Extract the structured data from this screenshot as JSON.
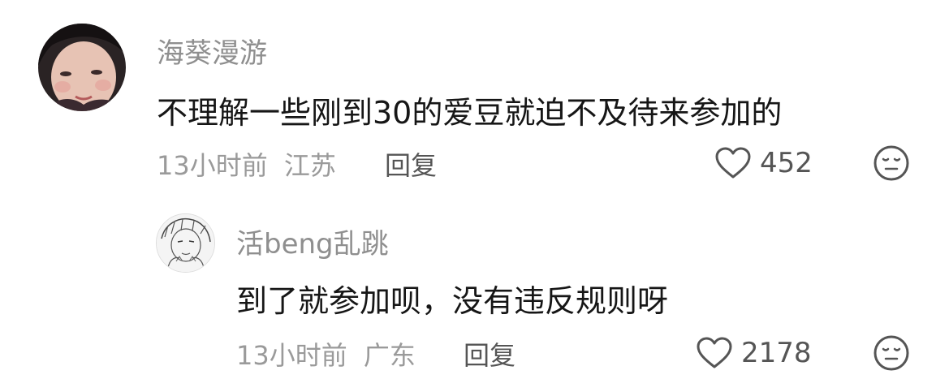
{
  "comments": [
    {
      "username": "海葵漫游",
      "text": "不理解一些刚到30的爱豆就迫不及待来参加的",
      "time": "13小时前",
      "location": "江苏",
      "reply_label": "回复",
      "likes": "452",
      "avatar_icon": "user-avatar-photo",
      "like_icon": "heart-outline-icon",
      "reaction_icon": "neutral-face-icon"
    },
    {
      "username": "活beng乱跳",
      "text": "到了就参加呗，没有违反规则呀",
      "time": "13小时前",
      "location": "广东",
      "reply_label": "回复",
      "likes": "2178",
      "avatar_icon": "user-avatar-sketch",
      "like_icon": "heart-outline-icon",
      "reaction_icon": "neutral-face-icon"
    }
  ],
  "colors": {
    "username": "#8f8f8f",
    "text": "#161616",
    "meta": "#9a9a9a",
    "action": "#555555"
  }
}
